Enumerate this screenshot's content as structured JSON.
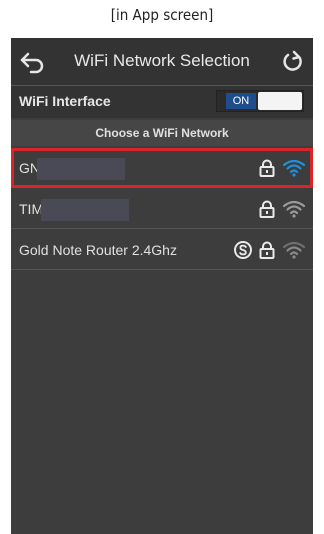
{
  "caption": "[in App screen]",
  "header": {
    "title": "WiFi Network Selection"
  },
  "interface": {
    "label": "WiFi Interface",
    "toggle_text": "ON"
  },
  "section_title": "Choose a WiFi Network",
  "networks": [
    {
      "name": "GN",
      "secured": true,
      "signal_icon": "wifi-strong-icon",
      "signal_color": "#1e90e0",
      "highlighted": true
    },
    {
      "name": "TIM",
      "secured": true,
      "signal_icon": "wifi-icon",
      "signal_color": "#9a9a9a",
      "highlighted": false
    },
    {
      "name": "Gold Note Router 2.4Ghz",
      "secured": true,
      "has_s_badge": true,
      "signal_icon": "wifi-weak-icon",
      "signal_color": "#8a8a8a",
      "highlighted": false
    }
  ],
  "colors": {
    "accent": "#1e90e0",
    "highlight": "#d9252a",
    "toggle_on": "#1e4c8c"
  }
}
